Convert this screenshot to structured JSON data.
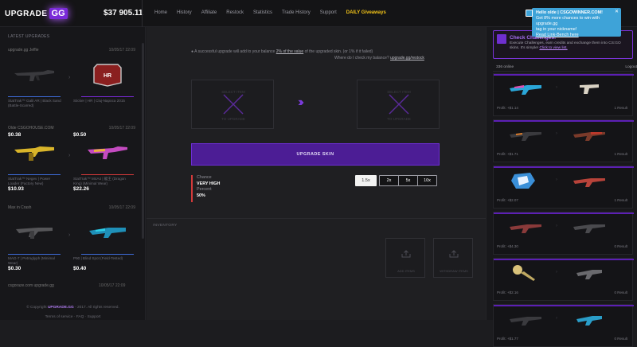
{
  "header": {
    "logo_text": "UPGRADE",
    "logo_badge": "GG",
    "balance": "$37 905.11",
    "nav": [
      "Home",
      "History",
      "Affiliate",
      "Restock",
      "Statistics",
      "Trade History",
      "Support",
      "DAILY Giveaways"
    ]
  },
  "notification": {
    "line1": "Hello olde | CSGOWINNER.COM!",
    "line2": "Get 8% more chances to win with upgrade.gg",
    "line3": "tag in your nickname!",
    "link": "Read Link-Bench here"
  },
  "left_panel": {
    "title": "LATEST UPGRADES",
    "cards": [
      {
        "user": "upgrade.gg Jeffie",
        "time": "10/05/17 22:09",
        "from_name": "StatTrak™ Galil AR | Black Sand (Battle-Scarred)",
        "from_price": "$0.38",
        "to_name": "Sticker | HR | Cluj-Napoca 2015",
        "to_price": "$0.50"
      },
      {
        "user": "Olde CSGOHOUSE.COM",
        "time": "10/05/17 22:09",
        "from_name": "StatTrak™ Negev | Power Loader (Factory New)",
        "from_price": "$10.93",
        "to_name": "StatTrak™ M4A4 | 龍王 (Dragon King) (Minimal Wear)",
        "to_price": "$22.26"
      },
      {
        "user": "Max in Crash",
        "time": "10/05/17 22:09",
        "from_name": "MAG-7 | Petroglyph (Minimal Wear)",
        "from_price": "$0.30",
        "to_name": "P90 | Blind Spot (Field-Tested)",
        "to_price": "$0.40"
      }
    ],
    "last_user": "csgoraze.com upgrade.gg",
    "last_time": "10/05/17 22:09",
    "footer_prefix": "© Copyright",
    "footer_brand": "UPGRADE.GG",
    "footer_suffix": "- 2017. All rights reserved.",
    "footer_links": "Terms of service  ·  FAQ  ·  Support"
  },
  "main": {
    "info_text": "A successful upgrade will add to your balance",
    "info_link": "2% of the value",
    "info_tail": "of the upgraded skin. (or 1% if it failed)",
    "check_q": "Where do I check my balance?",
    "check_link": "upgrade.gg/restock",
    "slot_left_top": "SELECT ITEM",
    "slot_left_bottom": "TO UPGRADE",
    "slot_right_top": "SELECT ITEM",
    "slot_right_bottom": "TO UPGRADE",
    "upgrade_button": "UPGRADE SKIN",
    "chance_label": "Chance",
    "chance_value": "VERY HIGH",
    "percent_label": "Percent",
    "percent_value": "50%",
    "multipliers": [
      "1.5x",
      "2x",
      "5x",
      "10x"
    ],
    "inventory_label": "INVENTORY",
    "add_items": "ADD ITEMS",
    "withdraw_items": "WITHDRAW ITEMS"
  },
  "right_panel": {
    "challenge_title": "Check Challenges!",
    "challenge_desc": "Execute Challenges, earn credits and exchange them into CS:GO skins. It's simple!",
    "challenge_link": "Click to view list.",
    "online": "336 online",
    "logout": "Logout",
    "feed": [
      {
        "profit": "Profit: +$1.14",
        "result": "1 Result"
      },
      {
        "profit": "Profit: +$1.71",
        "result": "1 Result"
      },
      {
        "profit": "Profit: +$2.07",
        "result": "1 Result"
      },
      {
        "profit": "Profit: +$4.30",
        "result": "0 Result"
      },
      {
        "profit": "Profit: +$2.16",
        "result": "0 Result"
      },
      {
        "profit": "Profit: +$1.77",
        "result": "0 Result"
      }
    ]
  },
  "colors": {
    "accent": "#7a2ad9",
    "upgrade_button": "#4c1d95",
    "notification": "#3ea3d8",
    "giveaway": "#f5c518"
  }
}
